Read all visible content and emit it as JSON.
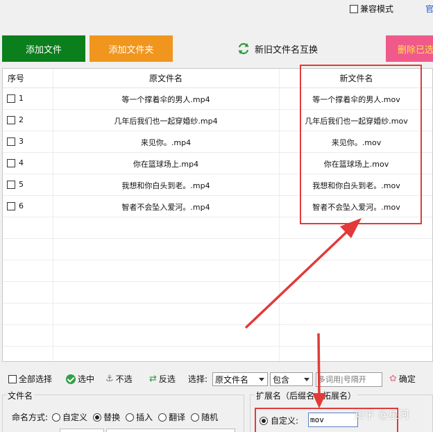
{
  "topbar": {
    "compat_label": "兼容模式",
    "gov_link": "官"
  },
  "toolbar": {
    "add_file": "添加文件",
    "add_folder": "添加文件夹",
    "swap_names": "新旧文件名互换",
    "delete_selected": "删除已选"
  },
  "table": {
    "headers": {
      "seq": "序号",
      "original": "原文件名",
      "new": "新文件名"
    },
    "rows": [
      {
        "num": "1",
        "original": "等一个撑着伞的男人.mp4",
        "new": "等一个撑着伞的男人.mov"
      },
      {
        "num": "2",
        "original": "几年后我们也一起穿婚纱.mp4",
        "new": "几年后我们也一起穿婚纱.mov"
      },
      {
        "num": "3",
        "original": "来见你。.mp4",
        "new": "来见你。.mov"
      },
      {
        "num": "4",
        "original": "你在篮球场上.mp4",
        "new": "你在篮球场上.mov"
      },
      {
        "num": "5",
        "original": "我想和你白头到老。.mp4",
        "new": "我想和你白头到老。.mov"
      },
      {
        "num": "6",
        "original": "智者不会坠入爱河。.mp4",
        "new": "智者不会坠入爱河。.mov"
      }
    ]
  },
  "filter": {
    "select_all": "全部选择",
    "check_selected": "选中",
    "uncheck": "不选",
    "invert": "反选",
    "select_label": "选择:",
    "field_value": "原文件名",
    "match_value": "包含",
    "keyword_placeholder": "多词用|号隔开",
    "confirm": "确定"
  },
  "filename_group": {
    "title": "文件名",
    "naming_label": "命名方式:",
    "options": [
      "自定义",
      "替换",
      "插入",
      "翻译",
      "随机"
    ],
    "selected": "替换"
  },
  "extension_group": {
    "title": "扩展名（后缀名，拓展名）",
    "custom_label": "自定义:",
    "custom_value": "mov"
  },
  "watermark": "知乎 @星河",
  "colors": {
    "add_file_bg": "#0a7f1b",
    "add_folder_bg": "#f0961e",
    "delete_bg": "#f05a8a",
    "annotation_red": "#e23a3a"
  }
}
